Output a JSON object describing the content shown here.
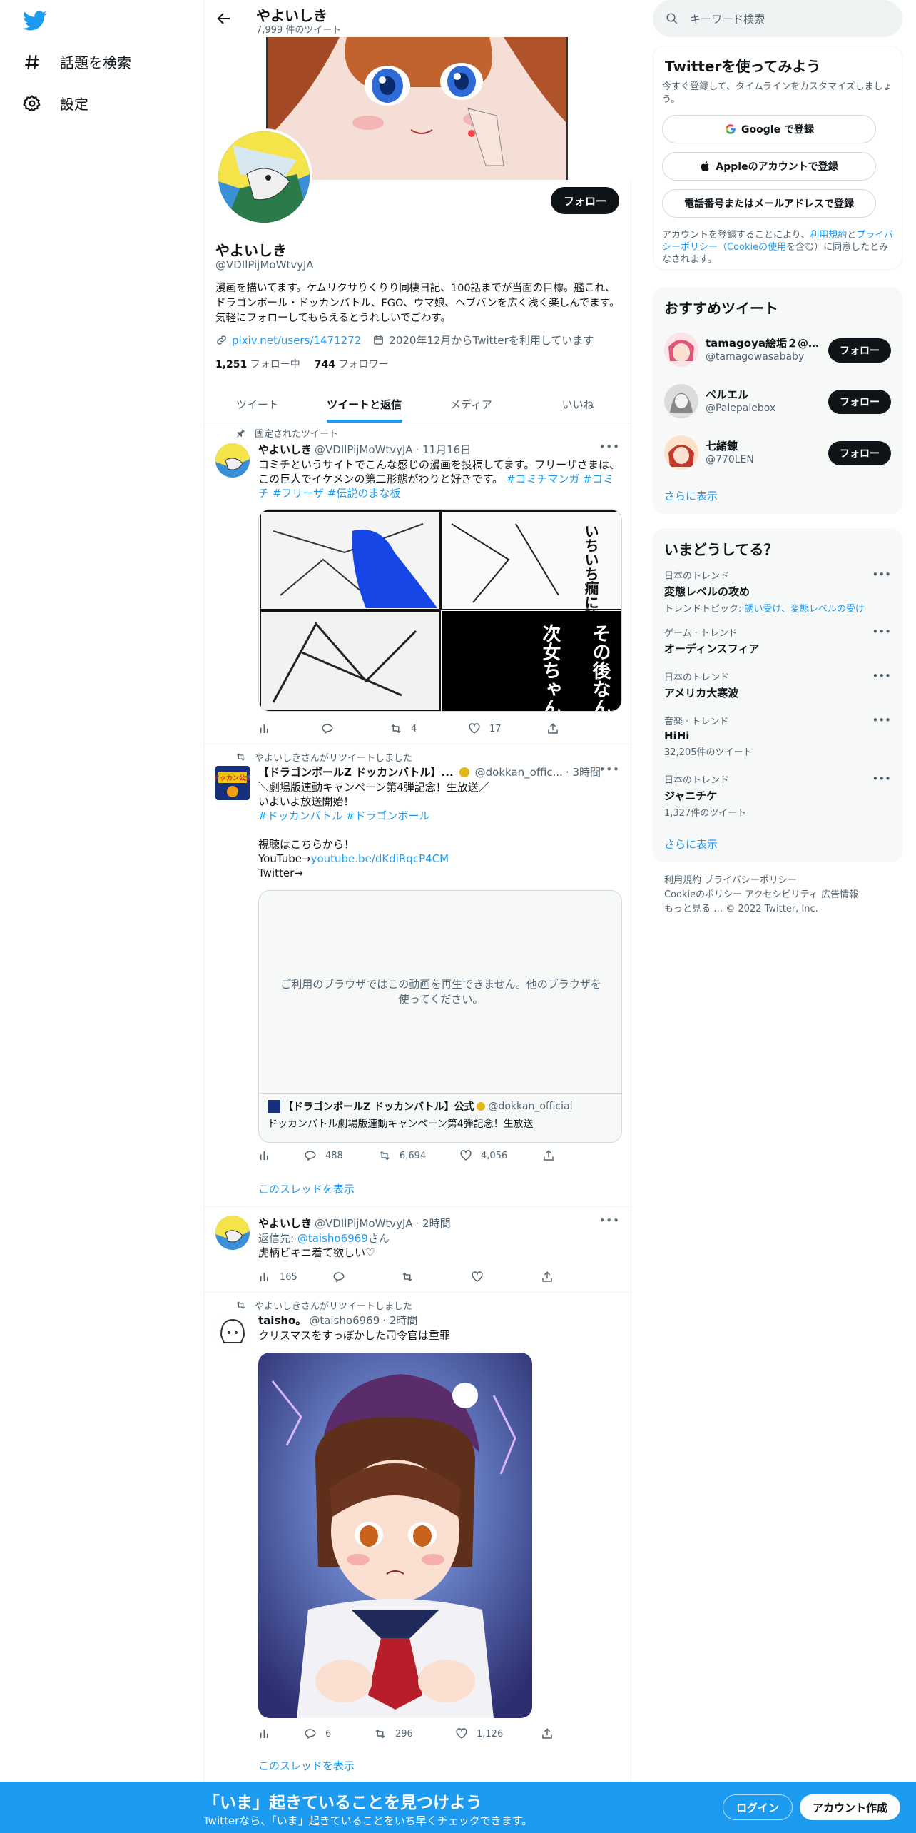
{
  "nav": {
    "explore_label": "話題を検索",
    "settings_label": "設定"
  },
  "header": {
    "name": "やよいしき",
    "tweet_count": "7,999 件のツイート"
  },
  "profile": {
    "name": "やよいしき",
    "handle": "@VDIlPijMoWtvyJA",
    "follow_label": "フォロー",
    "bio": "漫画を描いてます。ケムリクサりくりり同棲日記、100話までが当面の目標。艦これ、ドラゴンボール・ドッカンバトル、FGO、ウマ娘、ヘブバンを広く浅く楽しんでます。気軽にフォローしてもらえるとうれしいでごわす。",
    "link": "pixiv.net/users/1471272",
    "joined": "2020年12月からTwitterを利用しています",
    "following_count": "1,251",
    "following_label": "フォロー中",
    "followers_count": "744",
    "followers_label": "フォロワー"
  },
  "tabs": [
    "ツイート",
    "ツイートと返信",
    "メディア",
    "いいね"
  ],
  "tweets": {
    "t1": {
      "context": "固定されたツイート",
      "name": "やよいしき",
      "handle": "@VDIlPijMoWtvyJA",
      "time": "· 11月16日",
      "text": "コミチというサイトでこんな感じの漫画を投稿してます。フリーザさまは、この巨人でイケメンの第二形態がわりと好きです。",
      "hashtags": "#コミチマンガ  #コミチ  #フリーザ  #伝説のまな板",
      "manga_text_1": "その後なんやかんやあって",
      "manga_text_2": "次女ちゃん願いは叶うことありません",
      "manga_text_3": "いちいち癇に障るヤローだ",
      "replies": "",
      "retweets": "4",
      "likes": "17"
    },
    "t2": {
      "context": "やよいしきさんがリツイートしました",
      "name": "【ドラゴンボールZ ドッカンバトル】...",
      "handle": "@dokkan_offic...",
      "time": "· 3時間",
      "avatar_label": "ドッカン公式",
      "line1": "＼劇場版連動キャンペーン第4弾記念！生放送／",
      "line2": "いよいよ放送開始！",
      "hashtags": "#ドッカンバトル #ドラゴンボール",
      "line3": "視聴はこちらから！",
      "line4_prefix": "YouTube→",
      "line4_link": "youtube.be/dKdiRqcP4CM",
      "line5": "Twitter→",
      "video_msg": "ご利用のブラウザではこの動画を再生できません。他のブラウザを使ってください。",
      "quote_name": "【ドラゴンボールZ ドッカンバトル】公式",
      "quote_handle": "@dokkan_official",
      "quote_text": "ドッカンバトル劇場版連動キャンペーン第4弾記念！生放送",
      "views": "",
      "replies": "488",
      "retweets": "6,694",
      "likes": "4,056",
      "show_thread": "このスレッドを表示"
    },
    "t3": {
      "name": "やよいしき",
      "handle": "@VDIlPijMoWtvyJA",
      "time": "· 2時間",
      "reply_prefix": "返信先:",
      "reply_to": "@taisho6969",
      "reply_suffix": "さん",
      "text": "虎柄ビキニ着て欲しい♡",
      "views": "165"
    },
    "t4": {
      "context": "やよいしきさんがリツイートしました",
      "name": "taisho。",
      "handle": "@taisho6969",
      "time": "· 2時間",
      "text": "クリスマスをすっぽかした司令官は重罪",
      "replies": "6",
      "retweets": "296",
      "likes": "1,126",
      "show_thread": "このスレッドを表示"
    }
  },
  "right": {
    "search_placeholder": "キーワード検索",
    "signup_title": "Twitterを使ってみよう",
    "signup_sub": "今すぐ登録して、タイムラインをカスタマイズしましょう。",
    "google_btn": "Google で登録",
    "apple_btn": "Appleのアカウントで登録",
    "phone_btn": "電話番号またはメールアドレスで登録",
    "terms_1": "アカウントを登録することにより、",
    "terms_link1": "利用規約",
    "terms_2": "と",
    "terms_link2": "プライバシーポリシー（Cookieの使用",
    "terms_3": "を含む）に同意したとみなされます。",
    "suggest_title": "おすすめツイート",
    "suggestions": [
      {
        "name": "tamagoya絵垢２@肌...",
        "handle": "@tamagowasababy",
        "btn": "フォロー"
      },
      {
        "name": "ペルエル",
        "handle": "@Palepalebox",
        "btn": "フォロー"
      },
      {
        "name": "七緒錬",
        "handle": "@770LEN",
        "btn": "フォロー"
      }
    ],
    "show_more": "さらに表示",
    "trends_title": "いまどうしてる？",
    "trends": [
      {
        "cat": "日本のトレンド",
        "title": "変態レベルの攻め",
        "sub_prefix": "トレンドトピック: ",
        "sub_link": "誘い受け、変態レベルの受け"
      },
      {
        "cat": "ゲーム · トレンド",
        "title": "オーディンスフィア",
        "sub_prefix": "",
        "sub_link": ""
      },
      {
        "cat": "日本のトレンド",
        "title": "アメリカ大寒波",
        "sub_prefix": "",
        "sub_link": ""
      },
      {
        "cat": "音楽 · トレンド",
        "title": "HiHi",
        "sub_prefix": "32,205件のツイート",
        "sub_link": ""
      },
      {
        "cat": "日本のトレンド",
        "title": "ジャニチケ",
        "sub_prefix": "1,327件のツイート",
        "sub_link": ""
      }
    ],
    "trends_more": "さらに表示",
    "footer_line1": "利用規約   プライバシーポリシー",
    "footer_line2": "Cookieのポリシー   アクセシビリティ   広告情報",
    "footer_line3": "もっと見る …   © 2022 Twitter, Inc."
  },
  "bottom": {
    "title": "「いま」起きていることを見つけよう",
    "sub": "Twitterなら、「いま」起きていることをいち早くチェックできます。",
    "login": "ログイン",
    "signup": "アカウント作成"
  },
  "colors": {
    "accent": "#1d9bf0",
    "text": "#0f1419",
    "muted": "#536471"
  }
}
